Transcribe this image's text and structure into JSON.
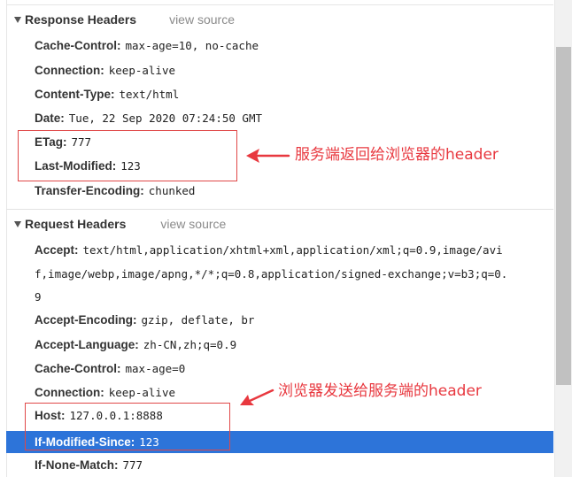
{
  "response_section": {
    "title": "Response Headers",
    "view_source": "view source",
    "headers": [
      {
        "name": "Cache-Control:",
        "value": "max-age=10, no-cache"
      },
      {
        "name": "Connection:",
        "value": "keep-alive"
      },
      {
        "name": "Content-Type:",
        "value": "text/html"
      },
      {
        "name": "Date:",
        "value": "Tue, 22 Sep 2020 07:24:50 GMT"
      },
      {
        "name": "ETag:",
        "value": "777"
      },
      {
        "name": "Last-Modified:",
        "value": "123"
      },
      {
        "name": "Transfer-Encoding:",
        "value": "chunked"
      }
    ]
  },
  "request_section": {
    "title": "Request Headers",
    "view_source": "view source",
    "accept": {
      "name": "Accept:",
      "line1": "text/html,application/xhtml+xml,application/xml;q=0.9,image/avi",
      "line2": "f,image/webp,image/apng,*/*;q=0.8,application/signed-exchange;v=b3;q=0.",
      "line3": "9"
    },
    "headers": [
      {
        "name": "Accept-Encoding:",
        "value": "gzip, deflate, br"
      },
      {
        "name": "Accept-Language:",
        "value": "zh-CN,zh;q=0.9"
      },
      {
        "name": "Cache-Control:",
        "value": "max-age=0"
      },
      {
        "name": "Connection:",
        "value": "keep-alive"
      },
      {
        "name": "Host:",
        "value": "127.0.0.1:8888"
      },
      {
        "name": "If-Modified-Since:",
        "value": "123"
      },
      {
        "name": "If-None-Match:",
        "value": "777"
      }
    ]
  },
  "annotations": {
    "response_note": "服务端返回给浏览器的header",
    "request_note": "浏览器发送给服务端的header"
  },
  "colors": {
    "annotation": "#e8383f",
    "selected_row": "#2d74d9"
  }
}
